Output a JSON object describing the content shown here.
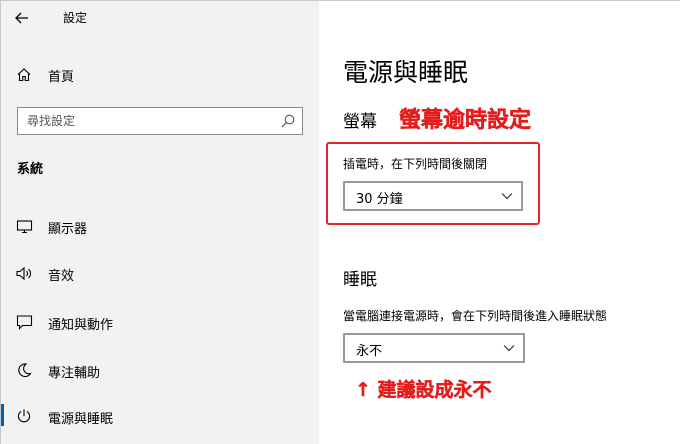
{
  "window": {
    "title": "設定"
  },
  "sidebar": {
    "home_label": "首頁",
    "search_placeholder": "尋找設定",
    "section_label": "系統",
    "items": [
      {
        "label": "顯示器",
        "icon": "monitor-icon"
      },
      {
        "label": "音效",
        "icon": "speaker-icon"
      },
      {
        "label": "通知與動作",
        "icon": "notification-icon"
      },
      {
        "label": "專注輔助",
        "icon": "moon-icon"
      },
      {
        "label": "電源與睡眠",
        "icon": "power-icon"
      }
    ],
    "active_index": 4
  },
  "main": {
    "page_title": "電源與睡眠",
    "screen": {
      "heading": "螢幕",
      "field_label": "插電時，在下列時間後關閉",
      "selected_value": "30 分鐘"
    },
    "sleep": {
      "heading": "睡眠",
      "field_label": "當電腦連接電源時，會在下列時間後進入睡眠狀態",
      "selected_value": "永不"
    }
  },
  "annotations": {
    "screen_timeout": "螢幕逾時設定",
    "recommend": "↑ 建議設成永不"
  },
  "colors": {
    "sidebar_bg": "#f2f2f2",
    "accent": "#0063b1",
    "annotation_red": "#e51c1c"
  }
}
